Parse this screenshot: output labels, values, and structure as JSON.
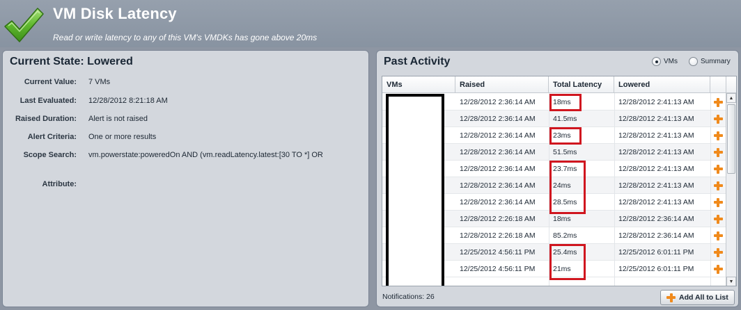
{
  "header": {
    "title": "VM Disk Latency",
    "subtitle": "Read or write latency to any of this VM's VMDKs has gone above 20ms",
    "icon": "checkmark-icon"
  },
  "current_state": {
    "title": "Current State: Lowered",
    "fields": [
      {
        "label": "Current Value:",
        "value": "7 VMs"
      },
      {
        "label": "Last Evaluated:",
        "value": "12/28/2012 8:21:18 AM"
      },
      {
        "label": "Raised Duration:",
        "value": "Alert is not raised"
      },
      {
        "label": "Alert Criteria:",
        "value": "One or more results"
      },
      {
        "label": "Scope Search:",
        "value": "vm.powerstate:poweredOn AND (vm.readLatency.latest:[30 TO *] OR"
      },
      {
        "label": "Attribute:",
        "value": ""
      }
    ]
  },
  "past_activity": {
    "title": "Past Activity",
    "view_options": [
      {
        "label": "VMs",
        "selected": true
      },
      {
        "label": "Summary",
        "selected": false
      }
    ],
    "columns": [
      "VMs",
      "Raised",
      "Total Latency",
      "Lowered"
    ],
    "rows": [
      {
        "raised": "12/28/2012 2:36:14 AM",
        "latency": "18ms",
        "lowered": "12/28/2012 2:41:13 AM"
      },
      {
        "raised": "12/28/2012 2:36:14 AM",
        "latency": "41.5ms",
        "lowered": "12/28/2012 2:41:13 AM"
      },
      {
        "raised": "12/28/2012 2:36:14 AM",
        "latency": "23ms",
        "lowered": "12/28/2012 2:41:13 AM"
      },
      {
        "raised": "12/28/2012 2:36:14 AM",
        "latency": "51.5ms",
        "lowered": "12/28/2012 2:41:13 AM"
      },
      {
        "raised": "12/28/2012 2:36:14 AM",
        "latency": "23.7ms",
        "lowered": "12/28/2012 2:41:13 AM"
      },
      {
        "raised": "12/28/2012 2:36:14 AM",
        "latency": "24ms",
        "lowered": "12/28/2012 2:41:13 AM"
      },
      {
        "raised": "12/28/2012 2:36:14 AM",
        "latency": "28.5ms",
        "lowered": "12/28/2012 2:41:13 AM"
      },
      {
        "raised": "12/28/2012 2:26:18 AM",
        "latency": "18ms",
        "lowered": "12/28/2012 2:36:14 AM"
      },
      {
        "raised": "12/28/2012 2:26:18 AM",
        "latency": "85.2ms",
        "lowered": "12/28/2012 2:36:14 AM"
      },
      {
        "raised": "12/25/2012 4:56:11 PM",
        "latency": "25.4ms",
        "lowered": "12/25/2012 6:01:11 PM"
      },
      {
        "raised": "12/25/2012 4:56:11 PM",
        "latency": "21ms",
        "lowered": "12/25/2012 6:01:11 PM"
      }
    ],
    "notifications": "Notifications: 26",
    "add_all_label": "Add All to List",
    "accent_color": "#f08a1c",
    "highlight_color": "#d0161f"
  }
}
